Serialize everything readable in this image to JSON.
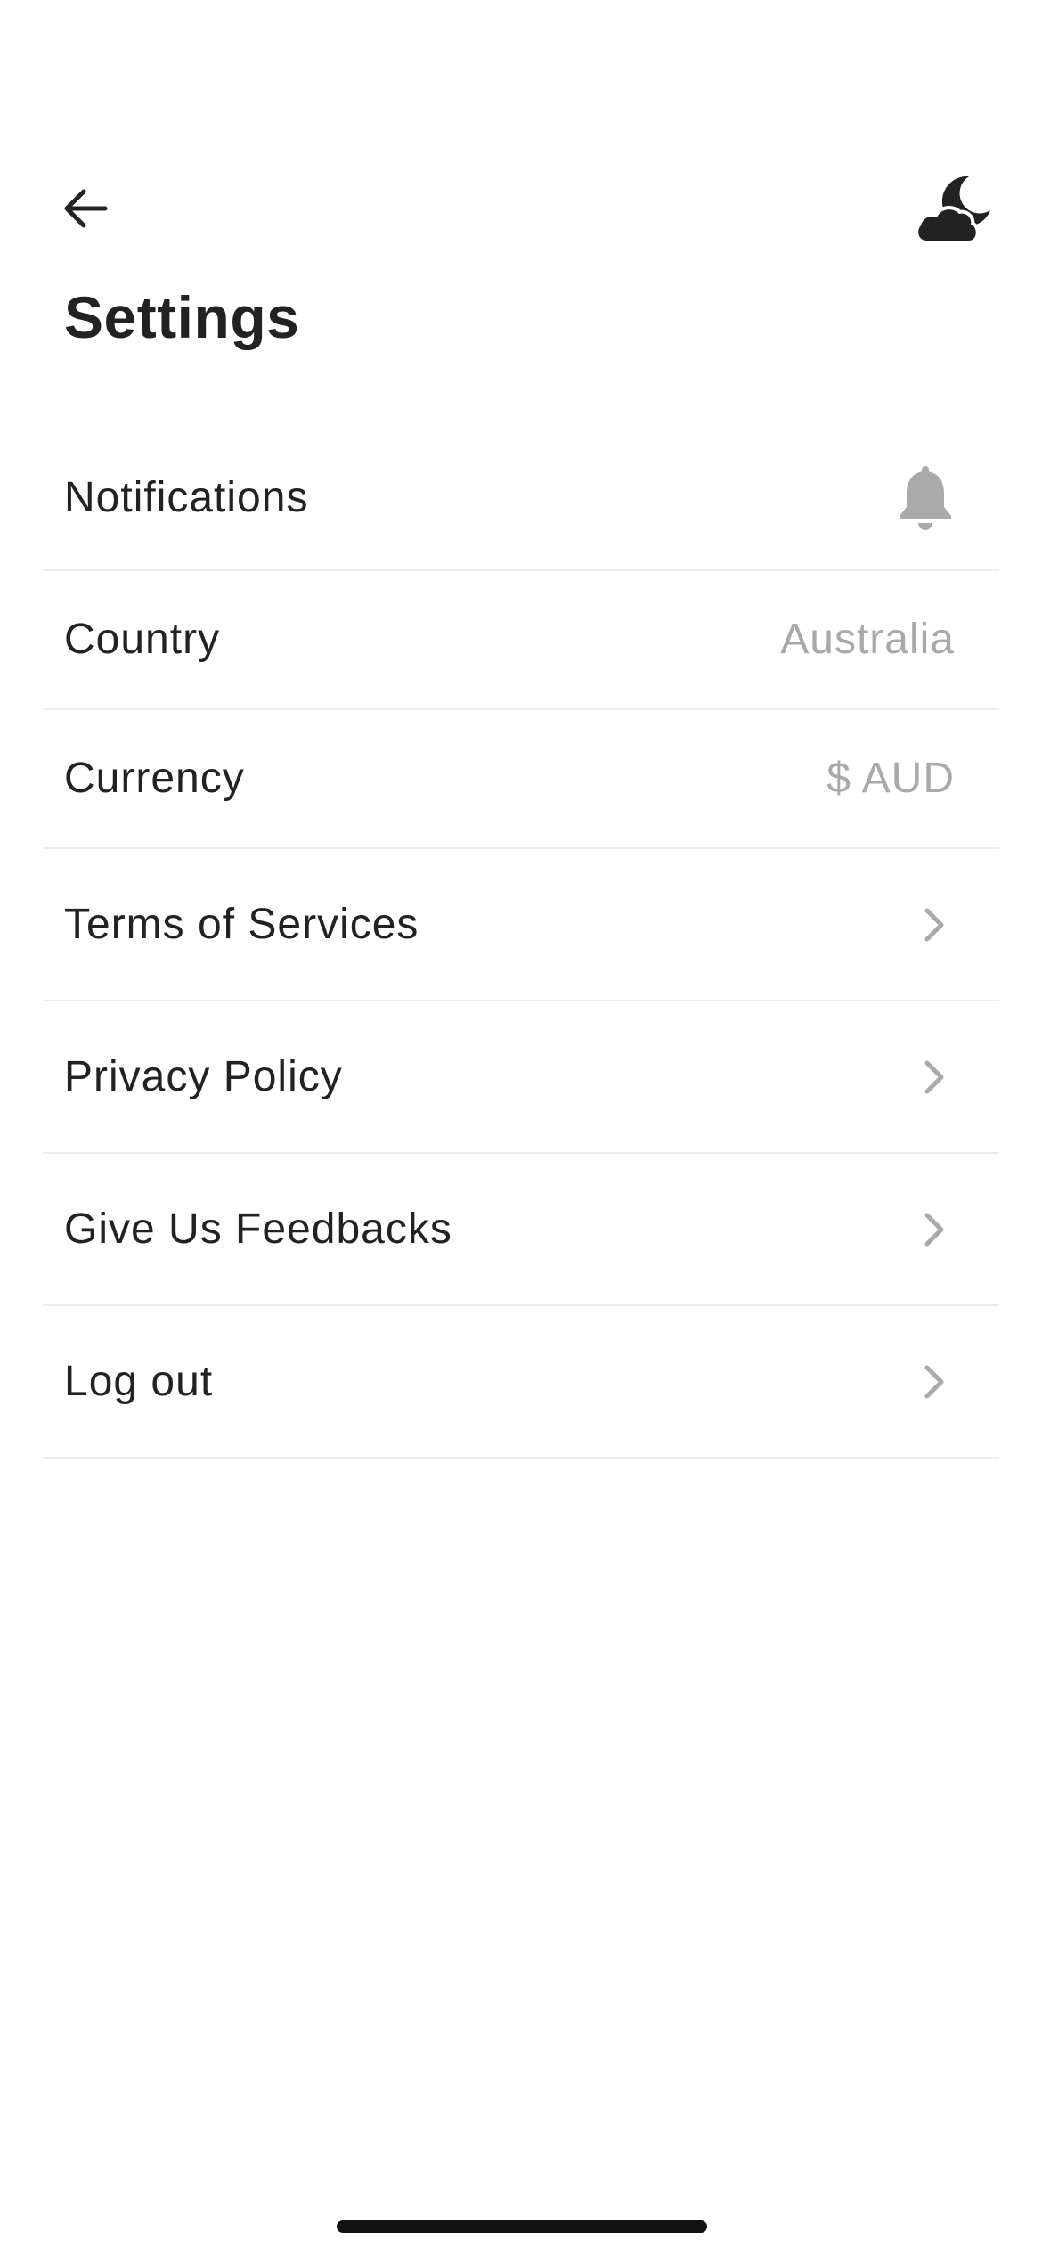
{
  "header": {
    "back_icon": "arrow-left-icon",
    "theme_icon": "cloud-moon-icon",
    "title": "Settings"
  },
  "settings": {
    "items": [
      {
        "label": "Notifications",
        "trailing": "bell-icon"
      },
      {
        "label": "Country",
        "value": "Australia"
      },
      {
        "label": "Currency",
        "value": "$ AUD"
      },
      {
        "label": "Terms of Services",
        "trailing": "chevron-right-icon"
      },
      {
        "label": "Privacy Policy",
        "trailing": "chevron-right-icon"
      },
      {
        "label": "Give Us Feedbacks",
        "trailing": "chevron-right-icon"
      },
      {
        "label": "Log out",
        "trailing": "chevron-right-icon"
      }
    ]
  },
  "colors": {
    "text": "#222222",
    "muted": "#a9a9a9",
    "icon_muted": "#aaaaaa",
    "divider": "#ececec",
    "background": "#ffffff"
  }
}
